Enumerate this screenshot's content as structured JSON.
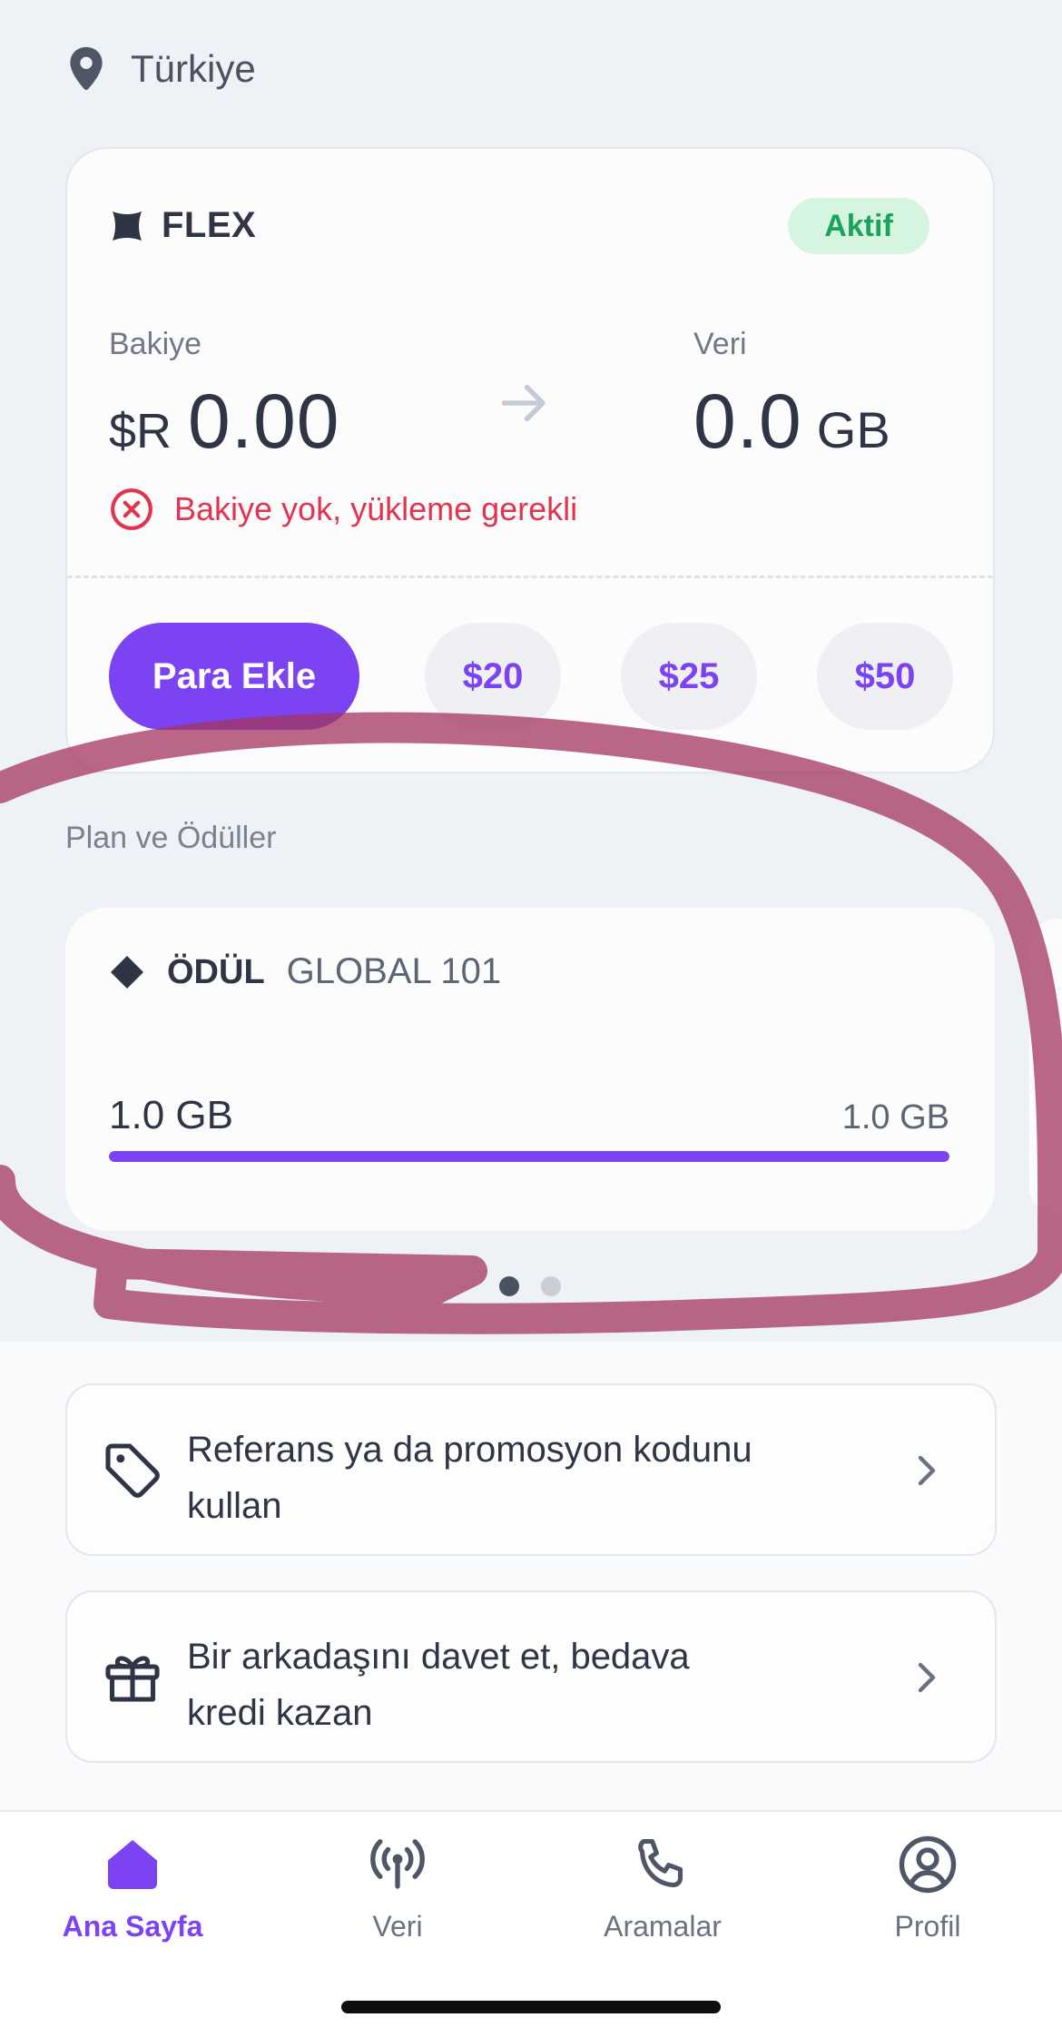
{
  "location": {
    "label": "Türkiye",
    "icon": "map-pin-icon"
  },
  "plan_card": {
    "plan_name": "FLEX",
    "status_badge": "Aktif",
    "balance_label": "Bakiye",
    "currency_symbol": "$R",
    "balance_value": "0.00",
    "data_label": "Veri",
    "data_value": "0.0",
    "data_unit": "GB",
    "warning": "Bakiye yok, yükleme gerekli",
    "add_money_button": "Para Ekle",
    "amount_options": [
      "$20",
      "$25",
      "$50"
    ]
  },
  "rewards": {
    "section_title": "Plan ve Ödüller",
    "card": {
      "title": "ÖDÜL",
      "subtitle": "GLOBAL 101",
      "used": "1.0 GB",
      "total": "1.0 GB",
      "progress_fraction": 1.0
    },
    "pager_pages": 2,
    "pager_active": 0
  },
  "actions": [
    {
      "label": "Referans ya da promosyon kodunu kullan",
      "icon": "tag-icon"
    },
    {
      "label": "Bir arkadaşını davet et, bedava kredi kazan",
      "icon": "gift-icon"
    }
  ],
  "tabs": [
    {
      "label": "Ana Sayfa",
      "icon": "home-icon",
      "active": true
    },
    {
      "label": "Veri",
      "icon": "antenna-icon",
      "active": false
    },
    {
      "label": "Aramalar",
      "icon": "phone-icon",
      "active": false
    },
    {
      "label": "Profil",
      "icon": "profile-icon",
      "active": false
    }
  ],
  "colors": {
    "accent": "#7b43f2",
    "success": "#1aa35a",
    "error": "#e0344f",
    "annotation": "#a3365f"
  }
}
